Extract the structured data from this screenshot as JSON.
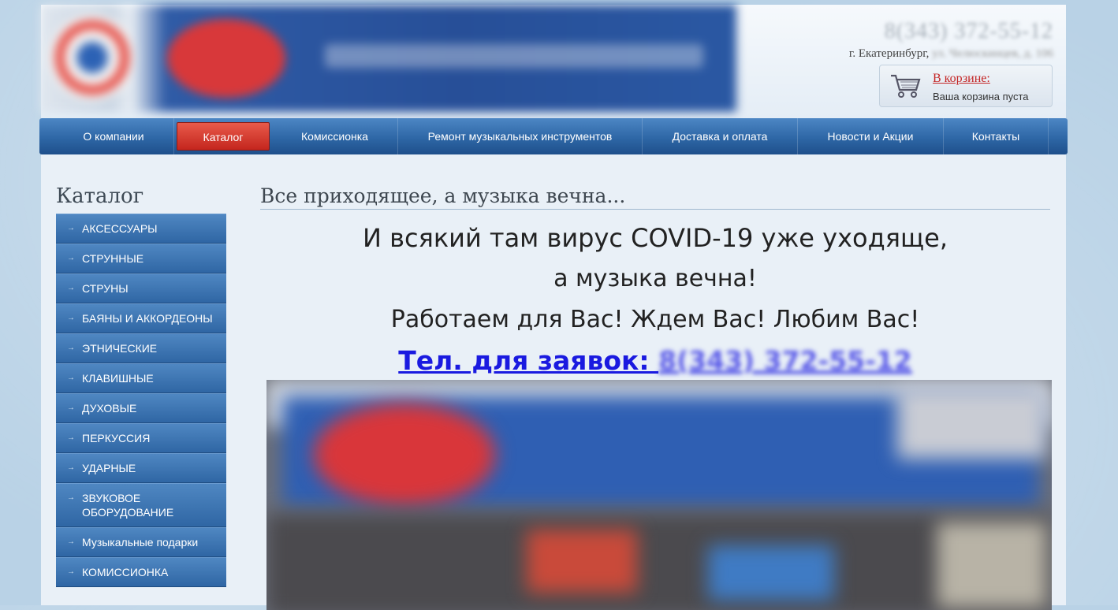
{
  "header": {
    "phone": "8(343) 372-55-12",
    "city": "г. Екатеринбург,",
    "address": "ул. Челюскинцев, д. 106",
    "cart": {
      "link_label": "В корзине:",
      "status": "Ваша корзина пуста",
      "icon": "shopping-cart-icon"
    }
  },
  "nav": {
    "items": [
      {
        "label": "О компании"
      },
      {
        "label": "Каталог",
        "active": true
      },
      {
        "label": "Комиссионка"
      },
      {
        "label": "Ремонт музыкальных инструментов"
      },
      {
        "label": "Доставка и оплата"
      },
      {
        "label": "Новости и Акции"
      },
      {
        "label": "Контакты"
      }
    ]
  },
  "sidebar": {
    "title": "Каталог",
    "items": [
      {
        "label": "АКСЕССУАРЫ"
      },
      {
        "label": "СТРУННЫЕ"
      },
      {
        "label": "СТРУНЫ"
      },
      {
        "label": "БАЯНЫ И АККОРДЕОНЫ"
      },
      {
        "label": "ЭТНИЧЕСКИЕ"
      },
      {
        "label": "КЛАВИШНЫЕ"
      },
      {
        "label": "ДУХОВЫЕ"
      },
      {
        "label": "ПЕРКУССИЯ"
      },
      {
        "label": "УДАРНЫЕ"
      },
      {
        "label": "ЗВУКОВОЕ ОБОРУДОВАНИЕ"
      },
      {
        "label": "Музыкальные подарки"
      },
      {
        "label": "КОМИССИОНКА"
      }
    ]
  },
  "main": {
    "title": "Все приходящее, а музыка вечна...",
    "line1": "И всякий там вирус COVID-19 уже уходяще,",
    "line2": "а музыка вечна!",
    "line3": "Работаем для Вас! Ждем Вас! Любим Вас!",
    "phone_label": "Тел. для заявок: ",
    "phone_value": "8(343) 372-55-12"
  },
  "colors": {
    "nav": "#2e67a6",
    "active": "#c4261e",
    "link": "#1a1ae0",
    "cart_link": "#c42525"
  }
}
